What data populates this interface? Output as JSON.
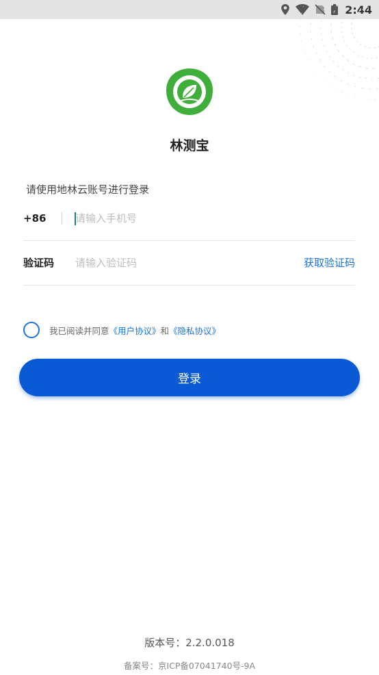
{
  "status_bar": {
    "time": "2:44",
    "icons": [
      "location-icon",
      "wifi-icon",
      "no-sim-icon",
      "battery-icon"
    ]
  },
  "app": {
    "name": "林测宝",
    "logo_icon": "leaf-logo-icon",
    "colors": {
      "logo_green": "#3fae3a",
      "accent_blue": "#1a73d6",
      "button_blue": "#0a5ad6"
    }
  },
  "login": {
    "hint": "请使用地林云账号进行登录",
    "phone_prefix": "+86",
    "phone_placeholder": "请输入手机号",
    "code_label": "验证码",
    "code_placeholder": "请输入验证码",
    "get_code": "获取验证码",
    "agree_prefix": "我已阅读并同意",
    "user_agreement": "《用户协议》",
    "agree_and": "和",
    "privacy_agreement": "《隐私协议》",
    "login_button": "登录"
  },
  "footer": {
    "version": "版本号：2.2.0.018",
    "icp": "备案号：京ICP备07041740号-9A"
  }
}
